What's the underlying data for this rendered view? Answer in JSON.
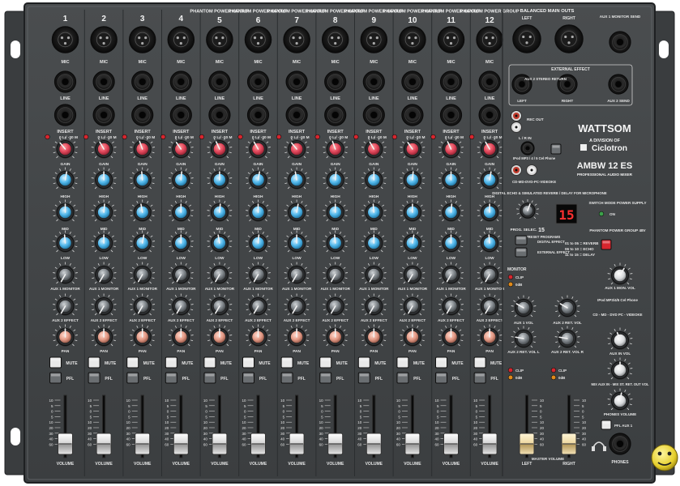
{
  "channels": [
    {
      "number": "1",
      "group": ""
    },
    {
      "number": "2",
      "group": ""
    },
    {
      "number": "3",
      "group": ""
    },
    {
      "number": "4",
      "group": ""
    },
    {
      "number": "5",
      "group": "PHANTOM POWER GROUP"
    },
    {
      "number": "6",
      "group": "PHANTOM POWER GROUP"
    },
    {
      "number": "7",
      "group": "PHANTOM POWER GROUP"
    },
    {
      "number": "8",
      "group": "PHANTOM POWER GROUP"
    },
    {
      "number": "9",
      "group": "PHANTOM POWER GROUP"
    },
    {
      "number": "10",
      "group": "PHANTOM POWER GROUP"
    },
    {
      "number": "11",
      "group": "PHANTOM POWER GROUP"
    },
    {
      "number": "12",
      "group": "PHANTOM POWER GROUP"
    }
  ],
  "labels": {
    "mic": "MIC",
    "line": "LINE",
    "insert": "INSERT",
    "gain": "GAIN",
    "gain_scale": "0 L / -20 M",
    "high": "HIGH",
    "mid": "MID",
    "low": "LOW",
    "aux1": "AUX 1 MONITOR",
    "aux2": "AUX 2 EFFECT",
    "pan": "PAN",
    "mute": "MUTE",
    "pfl": "PFL",
    "volume": "VOLUME",
    "fader_scale": [
      "10",
      "5",
      "0",
      "5",
      "10",
      "20",
      "30",
      "40",
      "60"
    ]
  },
  "master": {
    "balanced_outs": "BALANCED MAIN OUTS",
    "left": "LEFT",
    "right": "RIGHT",
    "aux1_monitor_send": "AUX 1 MONITOR SEND",
    "external_effect": "EXTERNAL EFFECT",
    "aux2_stereo_return": "AUX 2 STEREO RETURN",
    "aux2_send": "AUX 2 SEND",
    "rec_out": "REC OUT",
    "l_r_in": "L / R IN",
    "ipod_in": "IPod MP3 / 4 / 5 Cel Phone",
    "cd_md": "CD-MD-DVD-PC-VIDEOKE",
    "brand": "WATTSOM",
    "division": "A DIVISION OF",
    "company": "Ciclotron",
    "model": "AMBW 12 ES",
    "model_sub": "PROFESSIONAL AUDIO MIXER",
    "echo_title": "DIGITAL ECHO & SIMULATED REVERB / DELAY FOR MICROPHONE",
    "echo_display": "15",
    "preset_count": "15",
    "preset_label": "PRESET PROGRAMS",
    "prog_select": "PROG. SELEC.",
    "digital_effect": "DIGITAL EFFECT",
    "external_effect_btn": "EXTERNAL EFFECT",
    "presets": [
      "01 to 05 = REVERB",
      "06 to 10 = ECHO",
      "11 to 15 = DELAY"
    ],
    "switch_mode": "SWITCH MODE POWER SUPPLY",
    "on": "ON",
    "phantom_group": "PHANTOM POWER GROUP 48V",
    "monitor": "MONITOR",
    "clip": "CLIP",
    "zero_db": "0dB",
    "aux1_vol": "AUX 1 VOL",
    "aux2_ret_vol": "AUX 2 RET. VOL",
    "aux2_ret_vol_l": "AUX 2 RET. VOL L",
    "aux2_ret_vol_r": "AUX 2 RET. VOL R",
    "aux1_mon_vol": "AUX 1 MON. VOL",
    "ipod_aux": "IPod MP3/4/5 Cel Phone",
    "cd_aux": "CD - MD - DVD PC - VIDEOKE",
    "aux_in_vol": "AUX IN VOL",
    "mix_st_ret": "MIX AUX IN - MIX ST. RET. OUT VOL",
    "phones_vol": "PHONES VOLUME",
    "pfl_aux1": "PFL AUX 1",
    "master_volume": "MASTER VOLUME",
    "phones": "PHONES"
  }
}
